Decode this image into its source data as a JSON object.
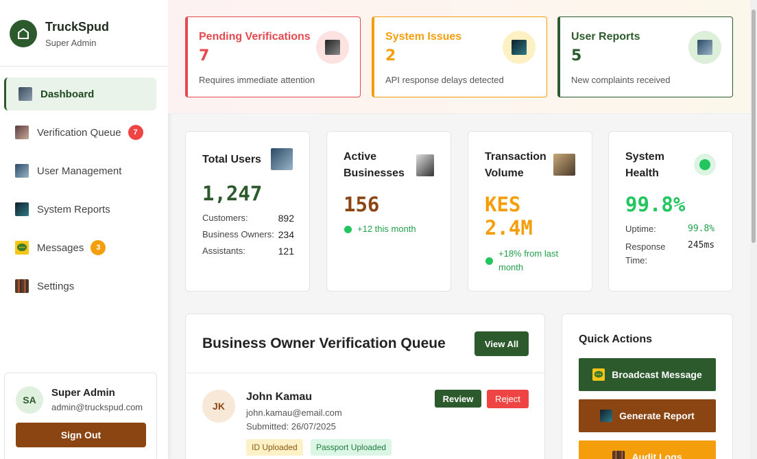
{
  "brand": {
    "name": "TruckSpud",
    "role": "Super Admin"
  },
  "sidebar": {
    "items": [
      {
        "label": "Dashboard",
        "icon": "dashboard-icon"
      },
      {
        "label": "Verification Queue",
        "icon": "verification-icon",
        "badge": "7",
        "badge_color": "#ef4444"
      },
      {
        "label": "User Management",
        "icon": "users-icon"
      },
      {
        "label": "System Reports",
        "icon": "reports-icon"
      },
      {
        "label": "Messages",
        "icon": "message-icon",
        "badge": "3",
        "badge_color": "#f59e0b"
      },
      {
        "label": "Settings",
        "icon": "settings-icon"
      }
    ]
  },
  "user": {
    "initials": "SA",
    "name": "Super Admin",
    "email": "admin@truckspud.com",
    "signout": "Sign Out"
  },
  "alerts": [
    {
      "title": "Pending Verifications",
      "value": "7",
      "desc": "Requires immediate attention",
      "color": "#e5484d"
    },
    {
      "title": "System Issues",
      "value": "2",
      "desc": "API response delays detected",
      "color": "#f59e0b"
    },
    {
      "title": "User Reports",
      "value": "5",
      "desc": "New complaints received",
      "color": "#2d5a2d"
    }
  ],
  "stats": {
    "total_users": {
      "title": "Total Users",
      "value": "1,247",
      "rows": [
        {
          "label": "Customers:",
          "value": "892"
        },
        {
          "label": "Business Owners:",
          "value": "234"
        },
        {
          "label": "Assistants:",
          "value": "121"
        }
      ]
    },
    "active_businesses": {
      "title_line1": "Active",
      "title_line2": "Businesses",
      "value": "156",
      "note": "+12 this month"
    },
    "transaction_volume": {
      "title_line1": "Transaction",
      "title_line2": "Volume",
      "value_line1": "KES",
      "value_line2": "2.4M",
      "note_line1": "+18% from last",
      "note_line2": "month"
    },
    "system_health": {
      "title_line1": "System",
      "title_line2": "Health",
      "value": "99.8%",
      "uptime_label": "Uptime:",
      "uptime_value": "99.8%",
      "response_label_line1": "Response",
      "response_label_line2": "Time:",
      "response_value": "245ms"
    }
  },
  "queue": {
    "title": "Business Owner Verification Queue",
    "view_all": "View All",
    "items": [
      {
        "initials": "JK",
        "name": "John Kamau",
        "email": "john.kamau@email.com",
        "submitted": "Submitted: 26/07/2025",
        "tags": [
          "ID Uploaded",
          "Passport Uploaded"
        ],
        "review": "Review",
        "reject": "Reject"
      }
    ]
  },
  "quick_actions": {
    "title": "Quick Actions",
    "buttons": [
      {
        "label": "Broadcast Message",
        "color": "#2d5a2d"
      },
      {
        "label": "Generate Report",
        "color": "#8b4513"
      },
      {
        "label": "Audit Logs",
        "color": "#f59e0b"
      }
    ]
  },
  "colors": {
    "brand_green": "#2d5a2d",
    "brown": "#8b4513",
    "orange": "#f59e0b",
    "red": "#ef4444"
  }
}
